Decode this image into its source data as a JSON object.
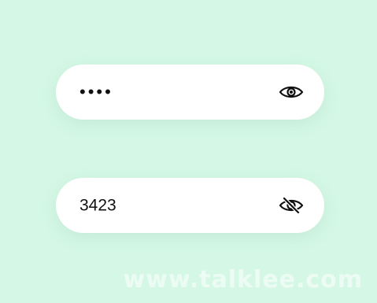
{
  "fields": [
    {
      "state": "hidden",
      "value": "••••",
      "toggle_icon": "eye-icon"
    },
    {
      "state": "visible",
      "value": "3423",
      "toggle_icon": "eye-slash-icon"
    }
  ],
  "watermark": "www.talklee.com",
  "colors": {
    "background": "#d5f8e6",
    "field": "#ffffff",
    "text": "#111111"
  }
}
